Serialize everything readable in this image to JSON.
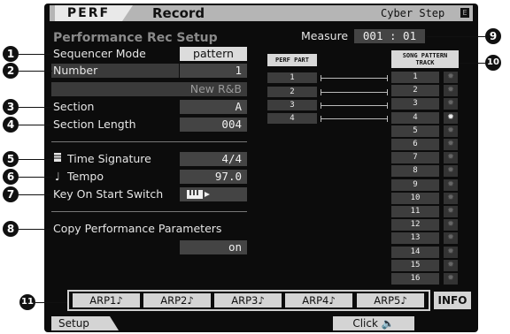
{
  "header": {
    "mode": "PERF",
    "page": "Record",
    "song_name": "Cyber Step",
    "corner_icon": "E"
  },
  "page_title": "Performance Rec Setup",
  "fields": {
    "sequencer_mode": {
      "label": "Sequencer Mode",
      "value": "pattern"
    },
    "number": {
      "label": "Number",
      "value": "1"
    },
    "pattern_name": "New R&B",
    "section": {
      "label": "Section",
      "value": "A"
    },
    "section_length": {
      "label": "Section Length",
      "value": "004"
    },
    "time_signature": {
      "label": "Time Signature",
      "value": "4/4"
    },
    "tempo": {
      "label": "Tempo",
      "value": "97.0"
    },
    "key_on_start": {
      "label": "Key On Start Switch"
    },
    "copy_perf": {
      "label": "Copy Performance Parameters",
      "value": "on"
    }
  },
  "measure": {
    "label": "Measure",
    "value": "001 : 01"
  },
  "perf_part": {
    "header": "PERF PART",
    "parts": [
      "1",
      "2",
      "3",
      "4"
    ]
  },
  "song_track": {
    "header_line1": "SONG PATTERN",
    "header_line2": "TRACK",
    "tracks": [
      "1",
      "2",
      "3",
      "4",
      "5",
      "6",
      "7",
      "8",
      "9",
      "10",
      "11",
      "12",
      "13",
      "14",
      "15",
      "16"
    ],
    "active_tracks": [
      "4"
    ]
  },
  "arp_buttons": [
    "ARP1♪",
    "ARP2♪",
    "ARP3♪",
    "ARP4♪",
    "ARP5♪"
  ],
  "info_button": "INFO",
  "bottom_tabs": {
    "setup": "Setup",
    "click": "Click 🔈"
  },
  "callouts": [
    "1",
    "2",
    "3",
    "4",
    "5",
    "6",
    "7",
    "8",
    "9",
    "10",
    "11"
  ],
  "icons": {
    "time_sig": "score-icon",
    "tempo": "note-icon",
    "key_on": "keyboard-icon"
  }
}
